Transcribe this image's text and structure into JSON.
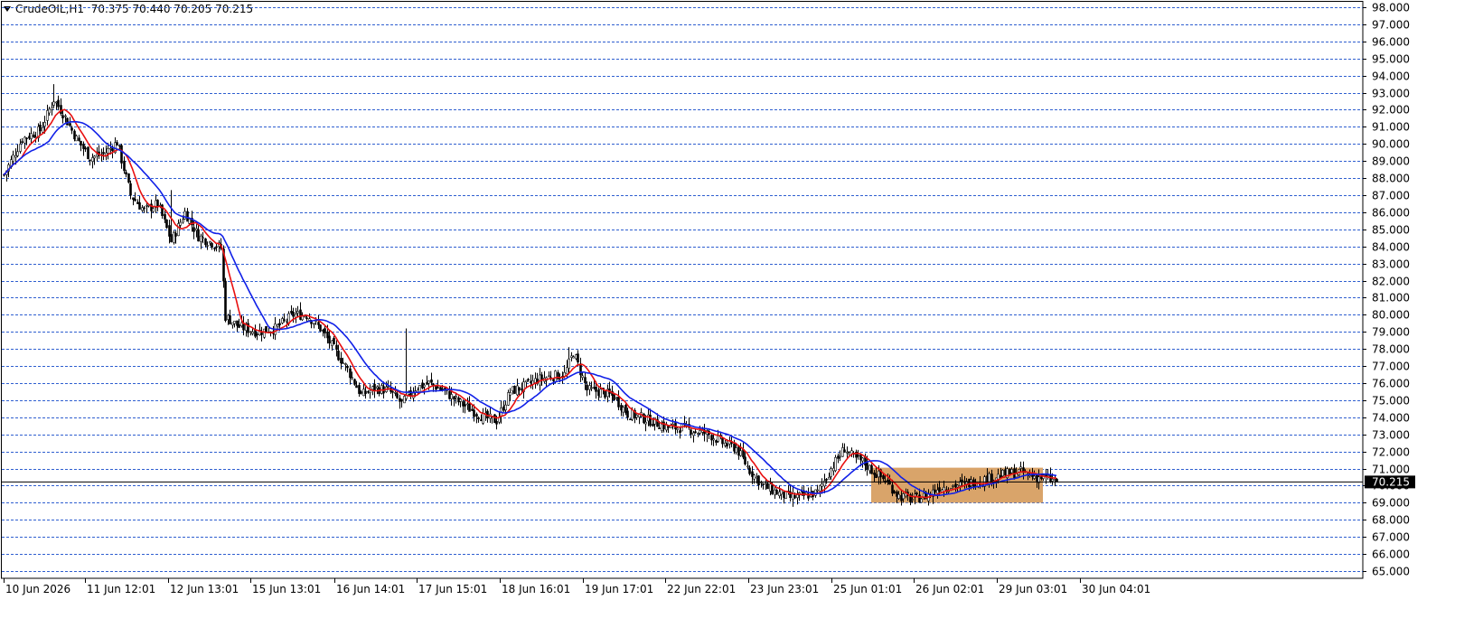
{
  "header": {
    "symbol": "CrudeOIL,H1",
    "ohlc": "70.375 70.440 70.205 70.215"
  },
  "colors": {
    "background": "#ffffff",
    "grid": "#2f5fd0",
    "candle": "#000000",
    "ma_fast": "#e81010",
    "ma_slow": "#1020e8",
    "zone_fill": "#d9a46a",
    "price_line": "#000000"
  },
  "chart_data": {
    "type": "candlestick",
    "title": "",
    "symbol": "CrudeOIL",
    "timeframe": "H1",
    "last_bar": {
      "open": 70.375,
      "high": 70.44,
      "low": 70.205,
      "close": 70.215
    },
    "current_price": 70.215,
    "ylim": [
      64.6,
      98.1
    ],
    "y_ticks": [
      "98.000",
      "97.000",
      "96.000",
      "95.000",
      "94.000",
      "93.000",
      "92.000",
      "91.000",
      "90.000",
      "89.000",
      "88.000",
      "87.000",
      "86.000",
      "85.000",
      "84.000",
      "83.000",
      "82.000",
      "81.000",
      "80.000",
      "79.000",
      "78.000",
      "77.000",
      "76.000",
      "75.000",
      "74.000",
      "73.000",
      "72.000",
      "71.000",
      "70.000",
      "69.000",
      "68.000",
      "67.000",
      "66.000",
      "65.000"
    ],
    "x_labels": [
      "10 Jun 2026",
      "11 Jun 12:01",
      "12 Jun 13:01",
      "15 Jun 13:01",
      "16 Jun 14:01",
      "17 Jun 15:01",
      "18 Jun 16:01",
      "19 Jun 17:01",
      "22 Jun 22:01",
      "23 Jun 23:01",
      "25 Jun 01:01",
      "26 Jun 02:01",
      "29 Jun 03:01",
      "30 Jun 04:01"
    ],
    "bars": 300,
    "close_path": [
      [
        0,
        88.2
      ],
      [
        8,
        90.3
      ],
      [
        16,
        90.8
      ],
      [
        22,
        92.6
      ],
      [
        26,
        91.8
      ],
      [
        32,
        90.3
      ],
      [
        38,
        89.2
      ],
      [
        44,
        89.4
      ],
      [
        50,
        90.1
      ],
      [
        56,
        87.0
      ],
      [
        62,
        86.1
      ],
      [
        68,
        86.5
      ],
      [
        74,
        84.3
      ],
      [
        80,
        86.0
      ],
      [
        86,
        84.6
      ],
      [
        92,
        84.2
      ],
      [
        96,
        83.9
      ],
      [
        98,
        79.9
      ],
      [
        104,
        79.3
      ],
      [
        112,
        79.0
      ],
      [
        120,
        79.2
      ],
      [
        128,
        80.0
      ],
      [
        134,
        80.0
      ],
      [
        140,
        79.2
      ],
      [
        146,
        78.0
      ],
      [
        152,
        76.8
      ],
      [
        158,
        75.3
      ],
      [
        164,
        75.7
      ],
      [
        170,
        75.6
      ],
      [
        176,
        74.8
      ],
      [
        182,
        75.7
      ],
      [
        188,
        76.0
      ],
      [
        194,
        75.6
      ],
      [
        200,
        75.0
      ],
      [
        206,
        74.5
      ],
      [
        212,
        74.0
      ],
      [
        218,
        73.8
      ],
      [
        224,
        75.5
      ],
      [
        230,
        75.8
      ],
      [
        236,
        76.2
      ],
      [
        242,
        76.4
      ],
      [
        248,
        76.5
      ],
      [
        252,
        77.8
      ],
      [
        258,
        75.6
      ],
      [
        264,
        75.5
      ],
      [
        270,
        75.2
      ],
      [
        276,
        74.2
      ],
      [
        282,
        74.0
      ],
      [
        288,
        73.7
      ],
      [
        294,
        73.4
      ],
      [
        300,
        73.4
      ],
      [
        306,
        73.2
      ],
      [
        312,
        73.0
      ],
      [
        318,
        72.5
      ],
      [
        324,
        72.2
      ],
      [
        330,
        70.9
      ],
      [
        336,
        70.0
      ],
      [
        342,
        69.6
      ],
      [
        348,
        69.3
      ],
      [
        354,
        69.4
      ],
      [
        360,
        69.6
      ],
      [
        366,
        71.0
      ],
      [
        372,
        72.2
      ],
      [
        376,
        71.6
      ],
      [
        380,
        71.4
      ],
      [
        384,
        70.9
      ],
      [
        390,
        70.3
      ],
      [
        396,
        69.4
      ],
      [
        402,
        69.2
      ],
      [
        408,
        69.4
      ],
      [
        414,
        69.9
      ],
      [
        420,
        70.0
      ],
      [
        426,
        70.1
      ],
      [
        432,
        70.3
      ],
      [
        438,
        70.5
      ],
      [
        444,
        70.7
      ],
      [
        450,
        70.8
      ],
      [
        454,
        70.6
      ],
      [
        458,
        70.5
      ],
      [
        462,
        70.4
      ],
      [
        466,
        70.215
      ]
    ],
    "spikes": [
      {
        "bar": 178,
        "high": 79.2
      },
      {
        "bar": 22,
        "high": 93.5
      },
      {
        "bar": 74,
        "high": 87.3
      },
      {
        "bar": 250,
        "high": 78.1
      }
    ],
    "zone": {
      "y_from": 69.0,
      "y_to": 71.05,
      "bar_from": 384,
      "bar_to": 460
    },
    "indicators": [
      {
        "type": "moving_average",
        "period": 9
      },
      {
        "type": "moving_average",
        "period": 21
      }
    ],
    "grid": true,
    "legend": "none"
  }
}
